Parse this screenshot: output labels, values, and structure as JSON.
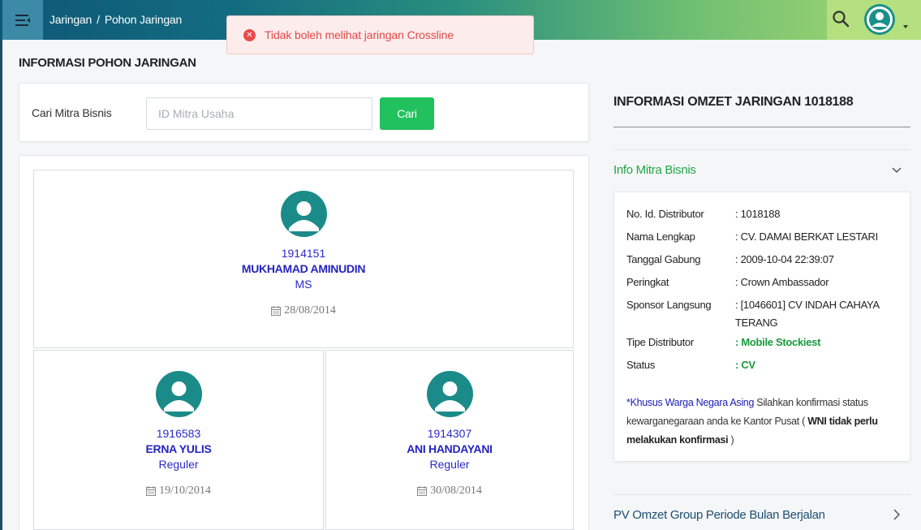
{
  "header": {
    "breadcrumb": [
      "Jaringan",
      "Pohon Jaringan"
    ],
    "separator": "/"
  },
  "toast": {
    "message": "Tidak boleh melihat jaringan Crossline",
    "type": "error"
  },
  "page_title": "INFORMASI POHON JARINGAN",
  "search": {
    "label": "Cari Mitra Bisnis",
    "placeholder": "ID Mitra Usaha",
    "value": "",
    "button": "Cari"
  },
  "tree": {
    "root": {
      "id": "1914151",
      "name": "MUKHAMAD AMINUDIN",
      "rank": "MS",
      "date": "28/08/2014"
    },
    "children": [
      {
        "id": "1916583",
        "name": "ERNA YULIS",
        "rank": "Reguler",
        "date": "19/10/2014"
      },
      {
        "id": "1914307",
        "name": "ANI HANDAYANI",
        "rank": "Reguler",
        "date": "30/08/2014"
      }
    ]
  },
  "omzet": {
    "title": "INFORMASI OMZET JARINGAN 1018188",
    "info_title": "Info Mitra Bisnis",
    "rows": [
      {
        "key": "No. Id. Distributor",
        "value": ": 1018188"
      },
      {
        "key": "Nama Lengkap",
        "value": ": CV. DAMAI BERKAT LESTARI"
      },
      {
        "key": "Tanggal Gabung",
        "value": ": 2009-10-04 22:39:07"
      },
      {
        "key": "Peringkat",
        "value": ": Crown Ambassador"
      },
      {
        "key": "Sponsor Langsung",
        "value": ": [1046601] CV INDAH CAHAYA TERANG"
      },
      {
        "key": "Tipe Distributor",
        "value": ": Mobile Stockiest"
      },
      {
        "key": "Status",
        "value": ": CV"
      }
    ],
    "note": {
      "highlight": "*Khusus Warga Negara Asing",
      "text": " Silahkan konfirmasi status kewarganegaraan anda ke Kantor Pusat ( ",
      "bold": "WNI tidak perlu melakukan konfirmasi",
      "end": " )"
    },
    "pv_title": "PV Omzet Group Periode Bulan Berjalan"
  },
  "colors": {
    "accent_green": "#21c15e",
    "error": "#e24a4a",
    "link_blue": "#2424c0",
    "avatar_teal": "#1a8b89"
  }
}
